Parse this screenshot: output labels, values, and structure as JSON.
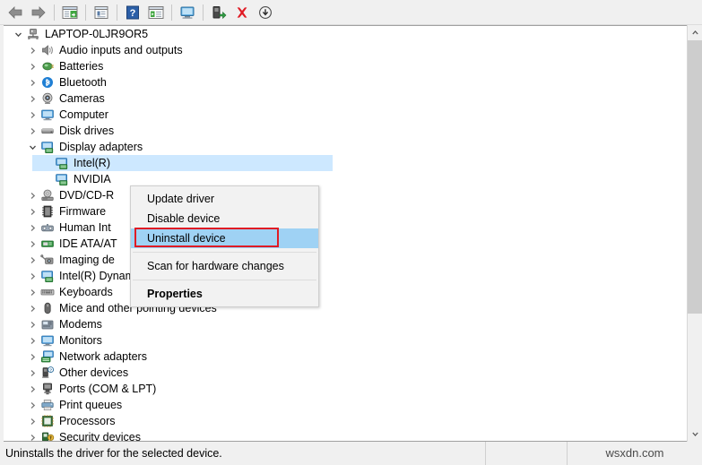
{
  "toolbar": {
    "items": [
      {
        "name": "back-arrow-icon",
        "label": "Back"
      },
      {
        "name": "forward-arrow-icon",
        "label": "Forward"
      },
      {
        "name": "separator",
        "label": ""
      },
      {
        "name": "show-hide-console-tree-icon",
        "label": "Show/Hide Console Tree"
      },
      {
        "name": "separator",
        "label": ""
      },
      {
        "name": "properties-icon",
        "label": "Properties"
      },
      {
        "name": "separator",
        "label": ""
      },
      {
        "name": "help-icon",
        "label": "Help"
      },
      {
        "name": "update-driver-icon",
        "label": "Update driver"
      },
      {
        "name": "separator",
        "label": ""
      },
      {
        "name": "scan-for-hardware-changes-icon",
        "label": "Scan for hardware changes"
      },
      {
        "name": "separator",
        "label": ""
      },
      {
        "name": "enable-device-icon",
        "label": "Enable device"
      },
      {
        "name": "uninstall-device-icon",
        "label": "Uninstall device"
      },
      {
        "name": "disable-device-icon",
        "label": "Disable device"
      }
    ]
  },
  "tree": {
    "root": {
      "label": "LAPTOP-0LJR9OR5",
      "icon": "computer-node-icon",
      "expanded": true
    },
    "items": [
      {
        "label": "Audio inputs and outputs",
        "icon": "speaker-icon",
        "indent": 1,
        "expandable": true,
        "expanded": false
      },
      {
        "label": "Batteries",
        "icon": "battery-icon",
        "indent": 1,
        "expandable": true,
        "expanded": false
      },
      {
        "label": "Bluetooth",
        "icon": "bluetooth-icon",
        "indent": 1,
        "expandable": true,
        "expanded": false
      },
      {
        "label": "Cameras",
        "icon": "camera-icon",
        "indent": 1,
        "expandable": true,
        "expanded": false
      },
      {
        "label": "Computer",
        "icon": "monitor-icon",
        "indent": 1,
        "expandable": true,
        "expanded": false
      },
      {
        "label": "Disk drives",
        "icon": "disk-drive-icon",
        "indent": 1,
        "expandable": true,
        "expanded": false
      },
      {
        "label": "Display adapters",
        "icon": "display-adapter-icon",
        "indent": 1,
        "expandable": true,
        "expanded": true
      },
      {
        "label": "Intel(R)",
        "icon": "display-adapter-icon",
        "indent": 2,
        "expandable": false,
        "selected": true
      },
      {
        "label": "NVIDIA",
        "icon": "display-adapter-icon",
        "indent": 2,
        "expandable": false
      },
      {
        "label": "DVD/CD-R",
        "icon": "dvd-drive-icon",
        "indent": 1,
        "expandable": true,
        "expanded": false
      },
      {
        "label": "Firmware",
        "icon": "firmware-icon",
        "indent": 1,
        "expandable": true,
        "expanded": false
      },
      {
        "label": "Human Int",
        "icon": "hid-icon",
        "indent": 1,
        "expandable": true,
        "expanded": false
      },
      {
        "label": "IDE ATA/AT",
        "icon": "ide-controller-icon",
        "indent": 1,
        "expandable": true,
        "expanded": false
      },
      {
        "label": "Imaging de",
        "icon": "imaging-device-icon",
        "indent": 1,
        "expandable": true,
        "expanded": false
      },
      {
        "label": "Intel(R) Dynamic Platform and Thermal Framework",
        "icon": "monitor-icon",
        "indent": 1,
        "expandable": true,
        "expanded": false
      },
      {
        "label": "Keyboards",
        "icon": "keyboard-icon",
        "indent": 1,
        "expandable": true,
        "expanded": false
      },
      {
        "label": "Mice and other pointing devices",
        "icon": "mouse-icon",
        "indent": 1,
        "expandable": true,
        "expanded": false
      },
      {
        "label": "Modems",
        "icon": "modem-icon",
        "indent": 1,
        "expandable": true,
        "expanded": false
      },
      {
        "label": "Monitors",
        "icon": "monitor-icon",
        "indent": 1,
        "expandable": true,
        "expanded": false
      },
      {
        "label": "Network adapters",
        "icon": "network-adapter-icon",
        "indent": 1,
        "expandable": true,
        "expanded": false
      },
      {
        "label": "Other devices",
        "icon": "other-device-icon",
        "indent": 1,
        "expandable": true,
        "expanded": false
      },
      {
        "label": "Ports (COM & LPT)",
        "icon": "port-icon",
        "indent": 1,
        "expandable": true,
        "expanded": false
      },
      {
        "label": "Print queues",
        "icon": "printer-icon",
        "indent": 1,
        "expandable": true,
        "expanded": false
      },
      {
        "label": "Processors",
        "icon": "processor-icon",
        "indent": 1,
        "expandable": true,
        "expanded": false
      },
      {
        "label": "Security devices",
        "icon": "security-device-icon",
        "indent": 1,
        "expandable": true,
        "expanded": false
      }
    ]
  },
  "context_menu": {
    "items": [
      {
        "label": "Update driver",
        "highlighted": false,
        "bold": false
      },
      {
        "label": "Disable device",
        "highlighted": false,
        "bold": false
      },
      {
        "label": "Uninstall device",
        "highlighted": true,
        "bold": false
      },
      {
        "separator": true
      },
      {
        "label": "Scan for hardware changes",
        "highlighted": false,
        "bold": false
      },
      {
        "separator": true
      },
      {
        "label": "Properties",
        "highlighted": false,
        "bold": true
      }
    ]
  },
  "annotation": {
    "highlight_color": "#e01b24",
    "target_label": "Uninstall device"
  },
  "statusbar": {
    "message": "Uninstalls the driver for the selected device.",
    "watermark": "wsxdn.com"
  },
  "colors": {
    "selection_blue": "#cde8ff",
    "menu_highlight": "#9fd2f4",
    "annotation_red": "#e01b24"
  }
}
